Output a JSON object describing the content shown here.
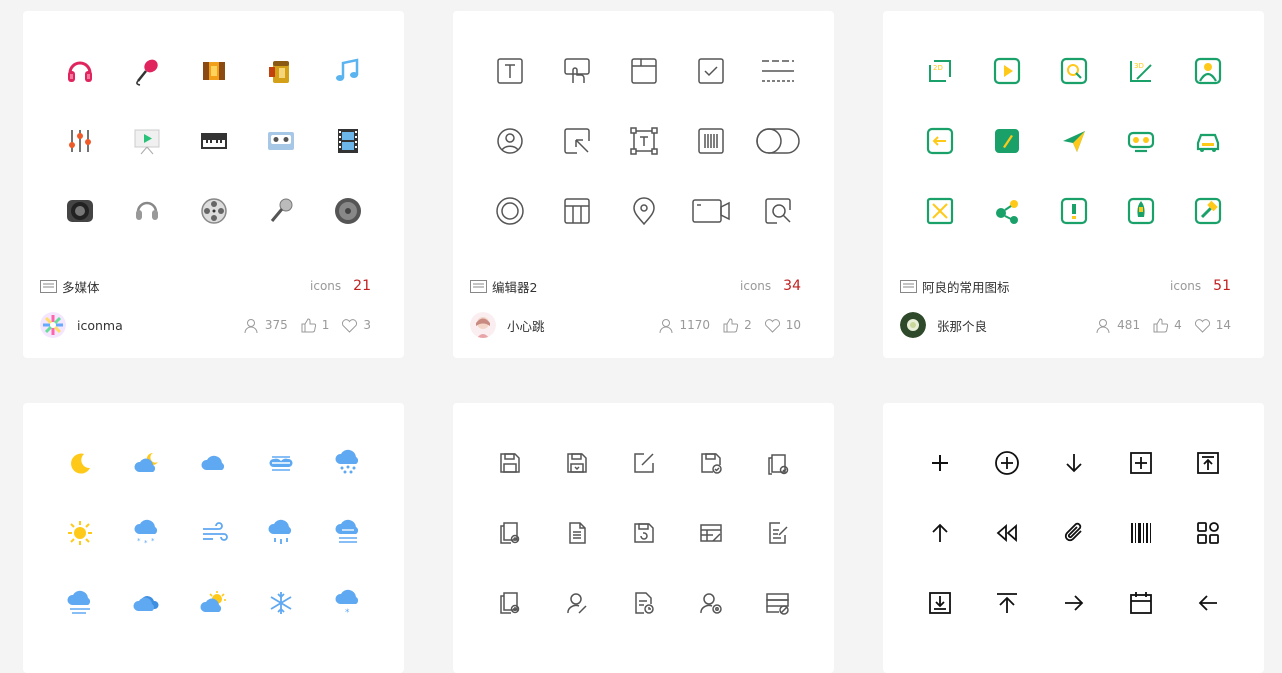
{
  "cards": [
    {
      "name": "多媒体",
      "icons_label": "icons",
      "icon_count": "21",
      "author": "iconma",
      "stats": {
        "users": "375",
        "likes": "1",
        "favorites": "3"
      },
      "icons": [
        "headphones-icon",
        "microphone-icon",
        "film-roll-icon",
        "film-canister-icon",
        "music-note-icon",
        "mixer-sliders-icon",
        "projector-screen-icon",
        "piano-keyboard-icon",
        "cassette-tape-icon",
        "film-strip-icon",
        "speaker-icon",
        "headset-icon",
        "film-reel-icon",
        "handheld-microphone-icon",
        "vinyl-record-icon"
      ]
    },
    {
      "name": "编辑器2",
      "icons_label": "icons",
      "icon_count": "34",
      "author": "小心跳",
      "stats": {
        "users": "1170",
        "likes": "2",
        "favorites": "10"
      },
      "icons": [
        "text-box-icon",
        "touch-select-icon",
        "window-icon",
        "checkbox-icon",
        "dashed-lines-icon",
        "user-circle-icon",
        "cursor-select-icon",
        "text-frame-icon",
        "barcode-icon",
        "toggle-icon",
        "radio-circle-icon",
        "layout-table-icon",
        "location-pin-icon",
        "video-camera-icon",
        "zoom-frame-icon"
      ]
    },
    {
      "name": "阿良的常用图标",
      "icons_label": "icons",
      "icon_count": "51",
      "author": "张那个良",
      "stats": {
        "users": "481",
        "likes": "4",
        "favorites": "14"
      },
      "icons": [
        "view-2d-icon",
        "play-video-icon",
        "search-frame-icon",
        "view-3d-icon",
        "person-frame-icon",
        "exit-icon",
        "note-pencil-icon",
        "paper-plane-icon",
        "vr-glasses-icon",
        "car-icon",
        "fullscreen-icon",
        "share-icon",
        "alert-icon",
        "rocket-icon",
        "hammer-icon"
      ]
    },
    {
      "name": "",
      "icons_label": "",
      "icon_count": "",
      "author": "",
      "stats": {
        "users": "",
        "likes": "",
        "favorites": ""
      },
      "icons": [
        "moon-icon",
        "cloud-moon-icon",
        "cloud-icon",
        "cloud-fog-icon",
        "cloud-rain-icon",
        "sun-icon",
        "cloud-snow-icon",
        "wind-icon",
        "cloud-drizzle-icon",
        "cloud-haze-icon",
        "fog-icon",
        "cloudy-icon",
        "sun-cloud-icon",
        "snowflake-icon",
        "cloud-snowflake-icon"
      ]
    },
    {
      "name": "",
      "icons_label": "",
      "icon_count": "",
      "author": "",
      "stats": {
        "users": "",
        "likes": "",
        "favorites": ""
      },
      "icons": [
        "save-icon",
        "save-as-icon",
        "edit-icon",
        "save-check-icon",
        "doc-copy-icon",
        "doc-copy-settings-icon",
        "document-icon",
        "save-refresh-icon",
        "table-edit-icon",
        "doc-edit-icon",
        "doc-copy-add-icon",
        "user-edit-icon",
        "doc-time-icon",
        "user-settings-icon",
        "server-block-icon"
      ]
    },
    {
      "name": "",
      "icons_label": "",
      "icon_count": "",
      "author": "",
      "stats": {
        "users": "",
        "likes": "",
        "favorites": ""
      },
      "icons": [
        "plus-icon",
        "plus-circle-icon",
        "arrow-down-icon",
        "plus-square-icon",
        "upload-icon",
        "arrow-up-icon",
        "rewind-icon",
        "paperclip-icon",
        "barcode-icon",
        "apps-grid-icon",
        "download-icon",
        "upload-top-icon",
        "arrow-right-icon",
        "calendar-icon",
        "arrow-left-icon"
      ]
    }
  ],
  "colors": {
    "accent_red": "#c21f1f",
    "green": "#1aa16a",
    "blue": "#5fa8f2",
    "yellow": "#ffc91a",
    "pink": "#e0245e"
  }
}
